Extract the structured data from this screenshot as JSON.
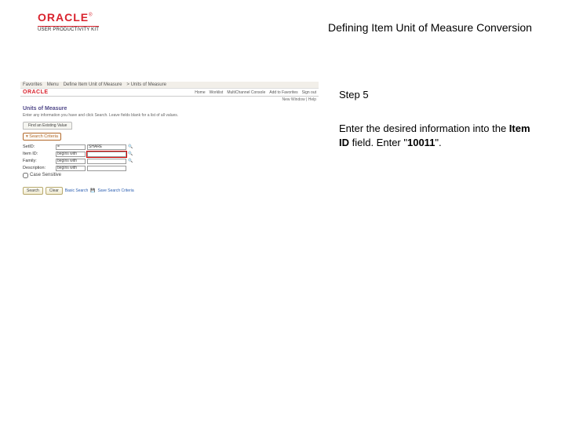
{
  "header": {
    "brand": "ORACLE",
    "tm": "®",
    "sub": "USER PRODUCTIVITY KIT",
    "title": "Defining Item Unit of Measure Conversion"
  },
  "step": {
    "label": "Step 5"
  },
  "instruction": {
    "lead": "Enter the desired information into the ",
    "field": "Item ID",
    "mid": " field. Enter \"",
    "value": "10011",
    "tail": "\"."
  },
  "app": {
    "nav1": {
      "favorites": "Favorites",
      "menu": "Menu",
      "breadcrumb": "Define Item Unit of Measure",
      "path": "> Units of Measure"
    },
    "brand": "ORACLE",
    "topright": {
      "home": "Home",
      "worklist": "Worklist",
      "multichannel": "MultiChannel Console",
      "addfav": "Add to Favorites",
      "signout": "Sign out"
    },
    "newwin": "New Window | Help",
    "section_title": "Units of Measure",
    "section_desc": "Enter any information you have and click Search. Leave fields blank for a list of all values.",
    "tab": "Find an Existing Value",
    "legend": "Search Criteria",
    "fields": {
      "setid_label": "SetID:",
      "setid_op": "=",
      "setid_val": "SHARE",
      "itemid_label": "Item ID:",
      "itemid_op": "begins with",
      "itemid_val": "",
      "family_label": "Family:",
      "family_op": "begins with",
      "family_val": "",
      "desc_label": "Description:",
      "desc_op": "begins with",
      "desc_val": "",
      "case": "Case Sensitive"
    },
    "buttons": {
      "search": "Search",
      "clear": "Clear",
      "basic": "Basic Search",
      "save": "Save Search Criteria"
    },
    "mag": "🔍"
  }
}
